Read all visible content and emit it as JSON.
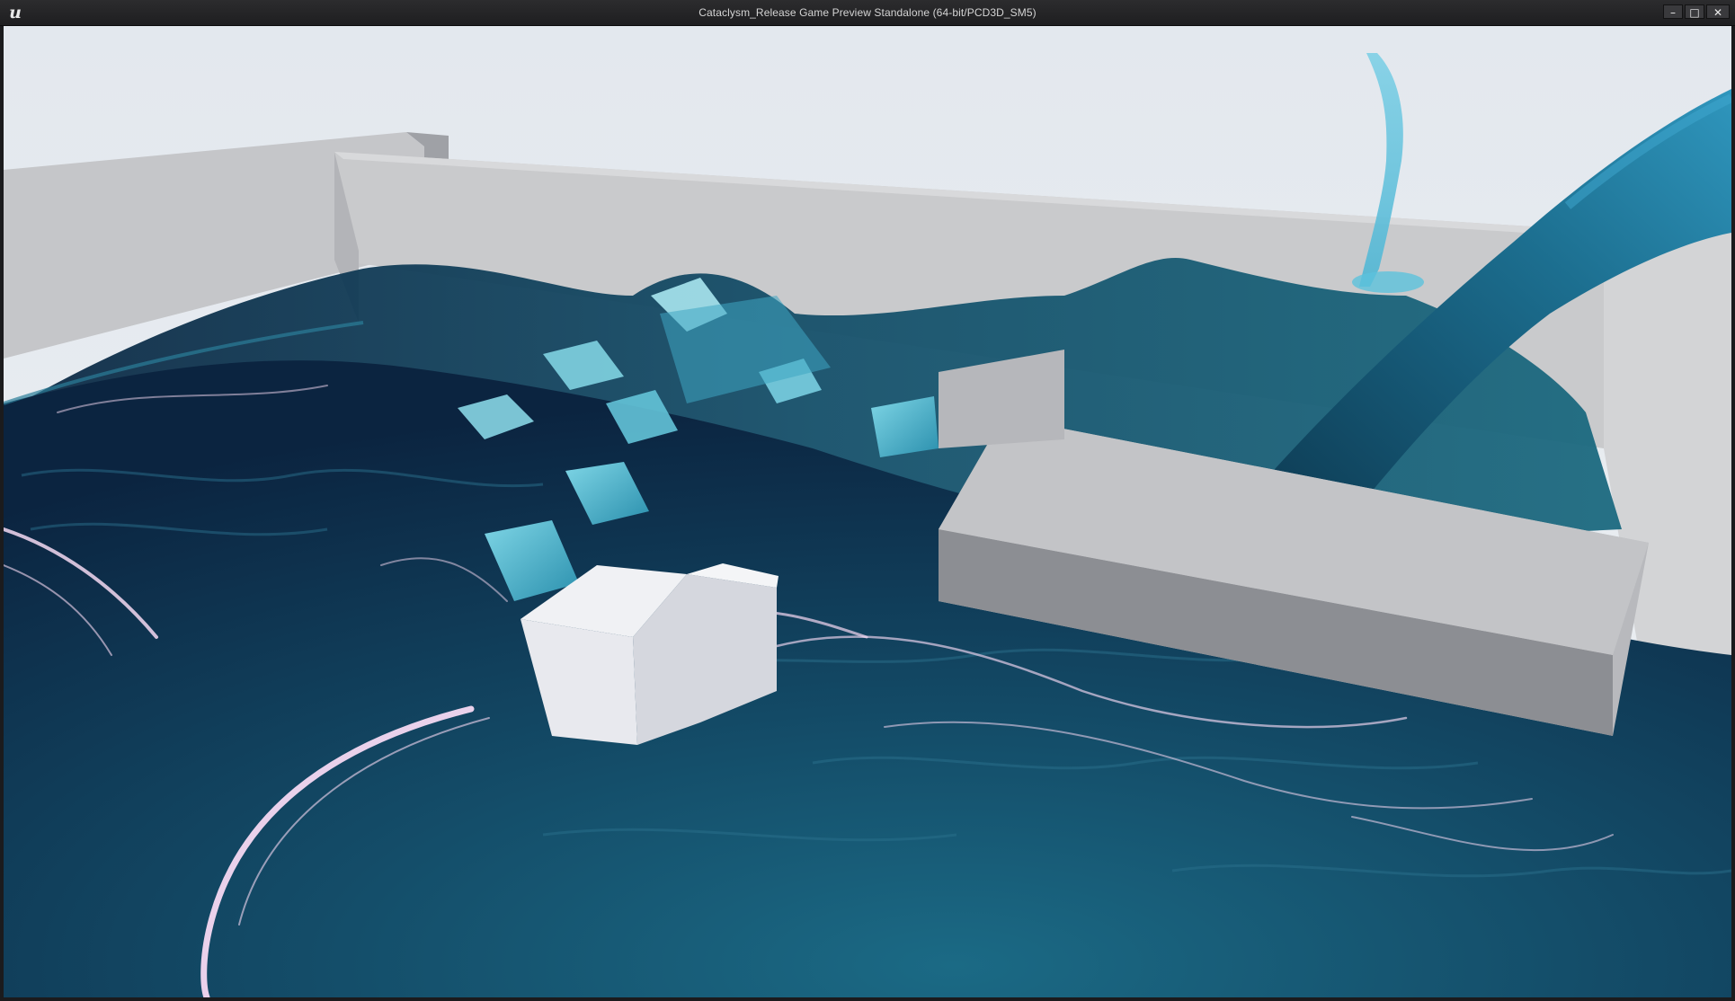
{
  "window": {
    "title": "Cataclysm_Release Game Preview Standalone (64-bit/PCD3D_SM5)",
    "logo_icon": "unreal-engine-logo-icon",
    "logo_glyph": "u",
    "controls": {
      "minimize_icon": "minimize-icon",
      "minimize_glyph": "–",
      "maximize_icon": "maximize-icon",
      "maximize_glyph": "□",
      "close_icon": "close-icon",
      "close_glyph": "✕"
    }
  },
  "viewport": {
    "scene": "fluid-simulation-viewport",
    "colors": {
      "sky": "#e6ebf0",
      "wall": "#c9c9cb",
      "wall_shadow": "#a9aaad",
      "water_deep": "#0b2440",
      "water_mid": "#134a66",
      "water_light": "#2d91ab",
      "foam": "#f5d9f2",
      "block_white": "#e8e9ee"
    }
  }
}
